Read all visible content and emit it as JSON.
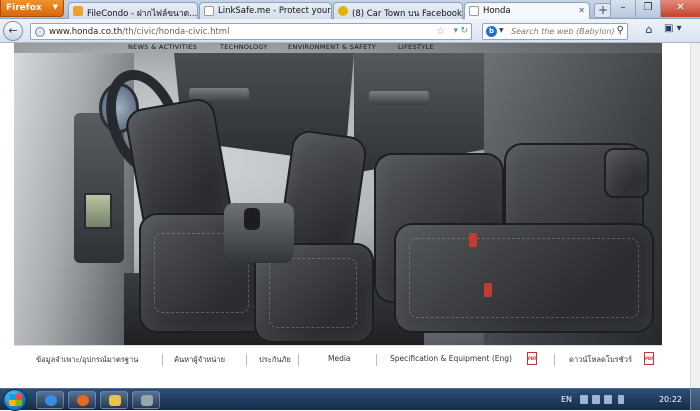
{
  "browser": {
    "app_button": "Firefox",
    "tabs": [
      {
        "label": "FileCondo - ฝากไฟล์ขนาด...",
        "icon": "filecondo-favicon",
        "color": "#f0a030"
      },
      {
        "label": "LinkSafe.me - Protect your...",
        "icon": "page-favicon",
        "color": "#ffffff"
      },
      {
        "label": "(8) Car Town บน Facebook",
        "icon": "cartown-favicon",
        "color": "#e2b400"
      },
      {
        "label": "Honda",
        "icon": "honda-favicon",
        "color": "#ffffff",
        "active": true
      }
    ],
    "new_tab": "+",
    "url_host": "www.honda.co.th",
    "url_path": "/th/civic/honda-civic.html",
    "search_placeholder": "Search the web (Babylon)",
    "search_engine_letter": "b"
  },
  "site": {
    "nav": [
      "NEWS & ACTIVITIES",
      "TECHNOLOGY",
      "ENVIRONMENT & SAFETY",
      "LIFESTYLE"
    ],
    "bottom_menu": [
      "ข้อมูลจำเพาะ/อุปกรณ์มาตรฐาน",
      "ค้นหาผู้จำหน่าย",
      "ประกันภัย",
      "Media",
      "Specification & Equipment (Eng)",
      "ดาวน์โหลดโบรชัวร์"
    ],
    "pdf_label": "PDF",
    "hero_alt": "Honda Civic interior leather seats"
  },
  "taskbar": {
    "pinned": [
      {
        "icon": "ie-icon",
        "color": "#3a8de0"
      },
      {
        "icon": "firefox-icon",
        "color": "#e8681b"
      },
      {
        "icon": "explorer-icon",
        "color": "#e8c44a"
      },
      {
        "icon": "app-icon",
        "color": "#9aa4b0"
      }
    ],
    "language": "EN",
    "clock": "20:22"
  },
  "colors": {
    "firefox_orange": "#e07a16",
    "taskbar_blue": "#1d3a60"
  }
}
